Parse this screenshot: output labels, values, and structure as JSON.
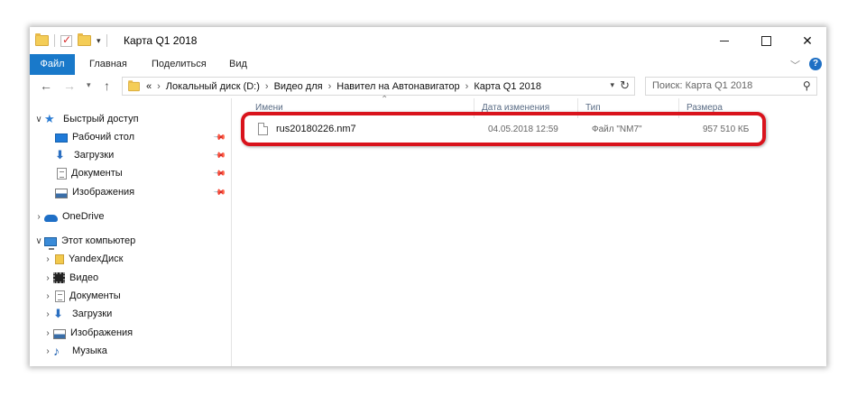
{
  "window": {
    "title": "Карта Q1 2018"
  },
  "ribbon": {
    "tabs": [
      {
        "label": "Файл",
        "active": true
      },
      {
        "label": "Главная"
      },
      {
        "label": "Поделиться"
      },
      {
        "label": "Вид"
      }
    ],
    "help_label": "?"
  },
  "address": {
    "overflow": "«",
    "crumbs": [
      "Локальный диск (D:)",
      "Видео для",
      "Навител на Автонавигатор",
      "Карта Q1 2018"
    ]
  },
  "search": {
    "placeholder": "Поиск: Карта Q1 2018"
  },
  "nav": {
    "quick_access": "Быстрый доступ",
    "desktop": "Рабочий стол",
    "downloads": "Загрузки",
    "documents": "Документы",
    "pictures": "Изображения",
    "onedrive": "OneDrive",
    "this_pc": "Этот компьютер",
    "yandex": "YandexДиск",
    "video": "Видео",
    "pc_documents": "Документы",
    "pc_downloads": "Загрузки",
    "pc_pictures": "Изображения",
    "music": "Музыка"
  },
  "columns": {
    "name": "Имени",
    "date": "Дата изменения",
    "type": "Тип",
    "size": "Размера"
  },
  "files": [
    {
      "name": "rus20180226.nm7",
      "date": "04.05.2018 12:59",
      "type": "Файл \"NM7\"",
      "size": "957 510 КБ"
    }
  ],
  "colors": {
    "accent": "#1979ca",
    "highlight": "#d9131c"
  }
}
